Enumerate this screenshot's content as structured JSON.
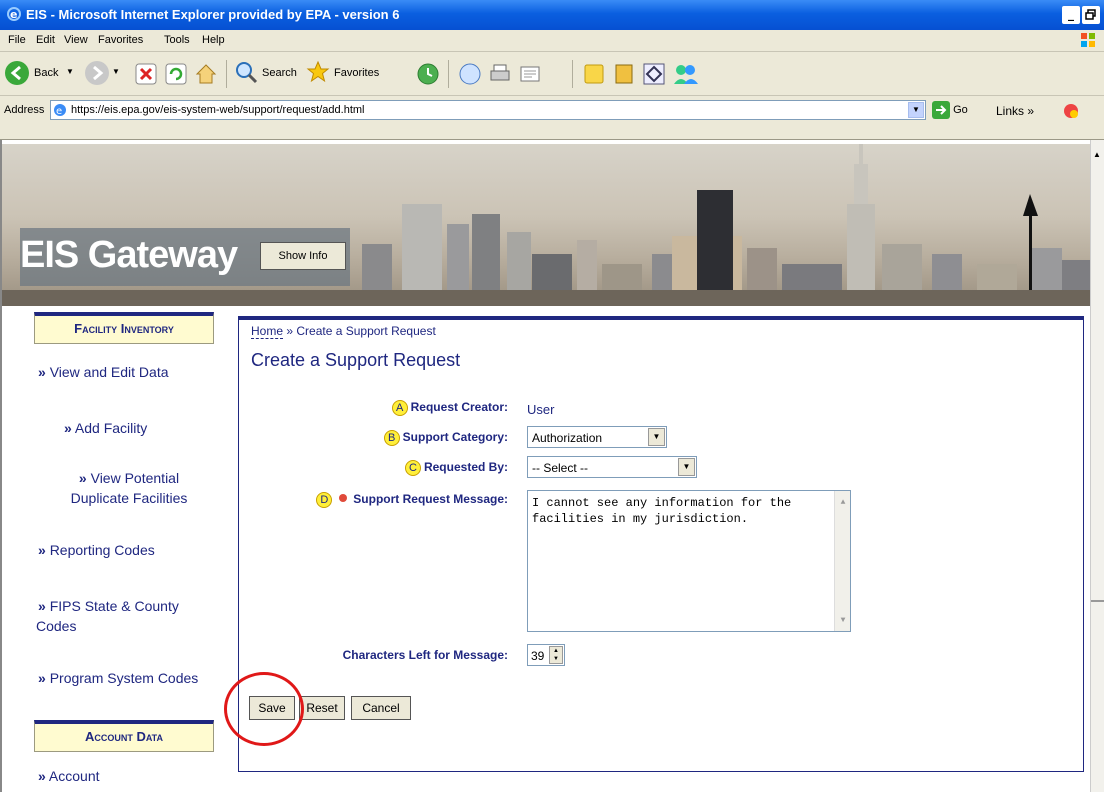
{
  "window": {
    "title": "EIS - Microsoft Internet Explorer provided by EPA - version 6",
    "controls": [
      "_",
      " ",
      "×"
    ]
  },
  "menu": [
    "File",
    "Edit",
    "View",
    "Favorites",
    "Tools",
    "Help"
  ],
  "toolbar": {
    "back": "Back",
    "search": "Search",
    "favorites": "Favorites"
  },
  "address": {
    "label": "Address",
    "url": "https://eis.epa.gov/eis-system-web/support/request/add.html",
    "go": "Go",
    "links": "Links"
  },
  "banner": {
    "title": "EIS Gateway",
    "show_info": "Show Info"
  },
  "sidebar": {
    "facility_heading": "Facility Inventory",
    "account_heading": "Account Data",
    "links": {
      "view_edit": "View and Edit Data",
      "add_facility": "Add Facility",
      "view_duplicates_1": "View Potential",
      "view_duplicates_2": "Duplicate Facilities",
      "reporting_codes": "Reporting Codes",
      "fips_1": "FIPS State & County",
      "fips_2": "Codes",
      "program_codes": "Program System Codes",
      "account": "Account"
    },
    "raquo": "»"
  },
  "breadcrumb": {
    "home": "Home",
    "sep": " » ",
    "current": "Create a Support Request"
  },
  "page": {
    "title": "Create a Support Request"
  },
  "form": {
    "request_creator": {
      "marker": "A",
      "label": "Request Creator:",
      "value": "User"
    },
    "support_category": {
      "marker": "B",
      "label": "Support Category:",
      "value": "Authorization"
    },
    "requested_by": {
      "marker": "C",
      "label": "Requested By:",
      "value": "-- Select --"
    },
    "message": {
      "marker": "D",
      "label": "Support Request Message:",
      "value_line1": "I cannot see any information for the",
      "value_line2": "facilities in my jurisdiction."
    },
    "chars_left": {
      "label": "Characters Left for Message:",
      "value": "39"
    }
  },
  "buttons": {
    "save": "Save",
    "reset": "Reset",
    "cancel": "Cancel"
  },
  "colors": {
    "titlebar": "#0a5fe0",
    "link": "#1f2780",
    "sidebar_head_bg": "#fffbd0",
    "marker": "#ffef3a",
    "required": "#e04a3a",
    "highlight_circle": "#e01818"
  }
}
